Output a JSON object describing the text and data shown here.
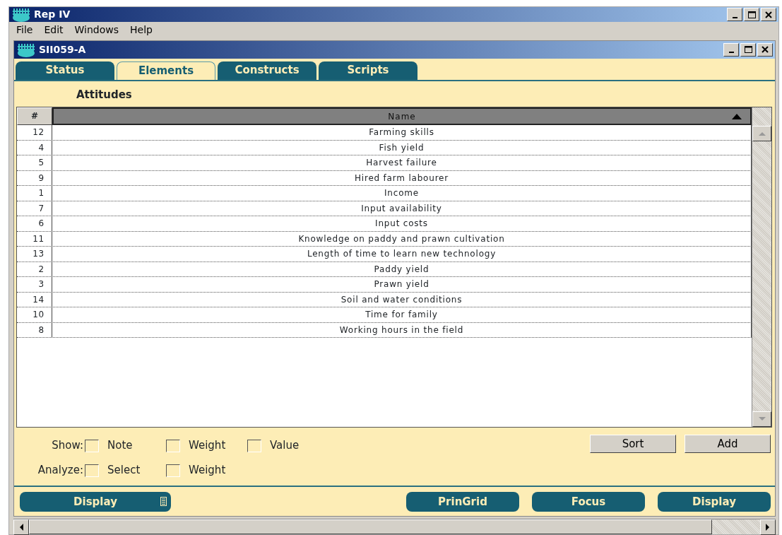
{
  "window": {
    "title": "Rep IV"
  },
  "menu": [
    "File",
    "Edit",
    "Windows",
    "Help"
  ],
  "document": {
    "title": "SII059-A"
  },
  "tabs": [
    {
      "label": "Status",
      "selected": false
    },
    {
      "label": "Elements",
      "selected": true
    },
    {
      "label": "Constructs",
      "selected": false
    },
    {
      "label": "Scripts",
      "selected": false
    }
  ],
  "heading": "Attitudes",
  "table": {
    "columns": [
      "#",
      "Name"
    ],
    "sort_ascending": true,
    "rows": [
      [
        "12",
        "Farming skills"
      ],
      [
        "4",
        "Fish yield"
      ],
      [
        "5",
        "Harvest failure"
      ],
      [
        "9",
        "Hired farm labourer"
      ],
      [
        "1",
        "Income"
      ],
      [
        "7",
        "Input availability"
      ],
      [
        "6",
        "Input costs"
      ],
      [
        "11",
        "Knowledge on paddy and prawn cultivation"
      ],
      [
        "13",
        "Length of time to learn new technology"
      ],
      [
        "2",
        "Paddy yield"
      ],
      [
        "3",
        "Prawn yield"
      ],
      [
        "14",
        "Soil and water conditions"
      ],
      [
        "10",
        "Time for family"
      ],
      [
        "8",
        "Working hours in the field"
      ]
    ]
  },
  "show": {
    "label": "Show:",
    "options": [
      {
        "label": "Note",
        "checked": false
      },
      {
        "label": "Weight",
        "checked": false
      },
      {
        "label": "Value",
        "checked": false
      }
    ]
  },
  "analyze": {
    "label": "Analyze:",
    "options": [
      {
        "label": "Select",
        "checked": false
      },
      {
        "label": "Weight",
        "checked": false
      }
    ]
  },
  "buttons": [
    "Sort",
    "Add"
  ],
  "bottom_buttons": [
    {
      "label": "Display",
      "menu": true
    },
    {
      "label": "PrinGrid",
      "menu": false
    },
    {
      "label": "Focus",
      "menu": false
    },
    {
      "label": "Display",
      "menu": false
    }
  ]
}
